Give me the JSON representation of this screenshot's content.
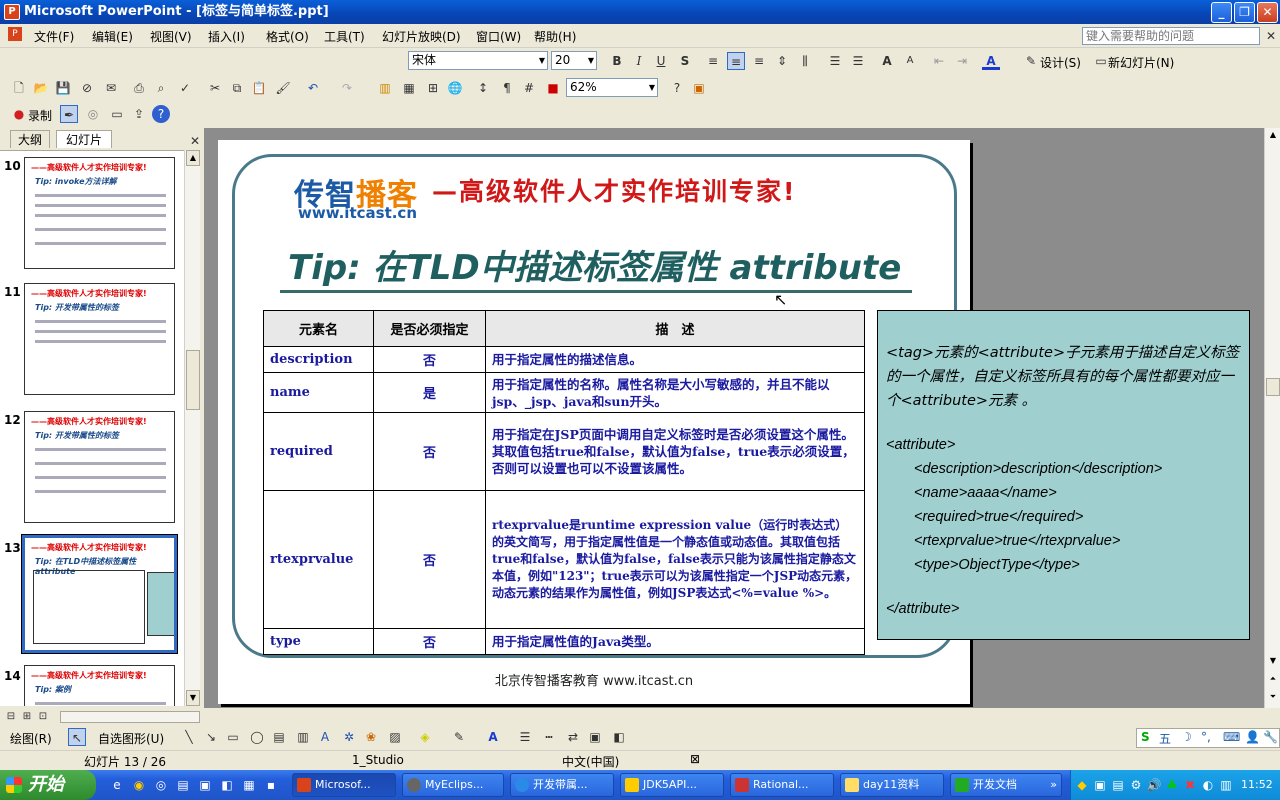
{
  "window": {
    "title": "Microsoft PowerPoint - [标签与简单标签.ppt]",
    "minimize": "_",
    "restore": "❐",
    "close": "✕"
  },
  "menu": {
    "items": [
      "文件(F)",
      "编辑(E)",
      "视图(V)",
      "插入(I)",
      "格式(O)",
      "工具(T)",
      "幻灯片放映(D)",
      "窗口(W)",
      "帮助(H)"
    ],
    "help_placeholder": "键入需要帮助的问题"
  },
  "format_toolbar": {
    "font": "宋体",
    "size": "20",
    "bold": "B",
    "italic": "I",
    "underline": "U",
    "shadow": "S",
    "design": "设计(S)",
    "new_slide": "新幻灯片(N)"
  },
  "standard_toolbar": {
    "zoom": "62%"
  },
  "record_toolbar": {
    "record": "录制"
  },
  "left_pane": {
    "tabs": [
      "大纲",
      "幻灯片"
    ],
    "slides": [
      {
        "num": "10",
        "tip": "Tip: invoke方法详解"
      },
      {
        "num": "11",
        "tip": "Tip: 开发带属性的标签"
      },
      {
        "num": "12",
        "tip": "Tip: 开发带属性的标签"
      },
      {
        "num": "13",
        "tip": "Tip: 在TLD中描述标签属性 attribute"
      },
      {
        "num": "14",
        "tip": "Tip: 案例"
      }
    ],
    "thumb_banner": "——高级软件人才实作培训专家!"
  },
  "slide": {
    "logo_cn_a": "传智",
    "logo_cn_b": "播客",
    "logo_en": "www.itcast.cn",
    "slogan": "—高级软件人才实作培训专家!",
    "title": "Tip: 在TLD中描述标签属性 attribute",
    "table": {
      "headers": [
        "元素名",
        "是否必须指定",
        "描　述"
      ],
      "rows": [
        [
          "description",
          "否",
          "用于指定属性的描述信息。"
        ],
        [
          "name",
          "是",
          "用于指定属性的名称。属性名称是大小写敏感的，并且不能以jsp、_jsp、java和sun开头。"
        ],
        [
          "required",
          "否",
          "用于指定在JSP页面中调用自定义标签时是否必须设置这个属性。其取值包括true和false，默认值为false，true表示必须设置，否则可以设置也可以不设置该属性。"
        ],
        [
          "rtexprvalue",
          "否",
          "rtexprvalue是runtime expression value（运行时表达式）的英文简写，用于指定属性值是一个静态值或动态值。其取值包括true和false，默认值为false，false表示只能为该属性指定静态文本值，例如\"123\"；true表示可以为该属性指定一个JSP动态元素，动态元素的结果作为属性值，例如JSP表达式<%=value %>。"
        ],
        [
          "type",
          "否",
          "用于指定属性值的Java类型。"
        ]
      ]
    },
    "footer": "北京传智播客教育 www.itcast.cn",
    "callout": {
      "intro": "<tag>元素的<attribute>子元素用于描述自定义标签的一个属性，自定义标签所具有的每个属性都要对应一个<attribute>元素 。",
      "lines": [
        "<attribute>",
        "<description>description</description>",
        "<name>aaaa</name>",
        "<required>true</required>",
        "<rtexprvalue>true</rtexprvalue>",
        "<type>ObjectType</type>",
        "</attribute>"
      ]
    }
  },
  "draw_toolbar": {
    "draw": "绘图(R)",
    "autoshapes": "自选图形(U)"
  },
  "status": {
    "slide": "幻灯片 13 / 26",
    "design": "1_Studio",
    "lang": "中文(中国)"
  },
  "taskbar": {
    "start": "开始",
    "tasks": [
      "Microsof...",
      "MyEclips...",
      "开发带属...",
      "JDK5API...",
      "Rational...",
      "day11资料",
      "开发文档"
    ],
    "clock": "11:52",
    "ime": "五"
  }
}
